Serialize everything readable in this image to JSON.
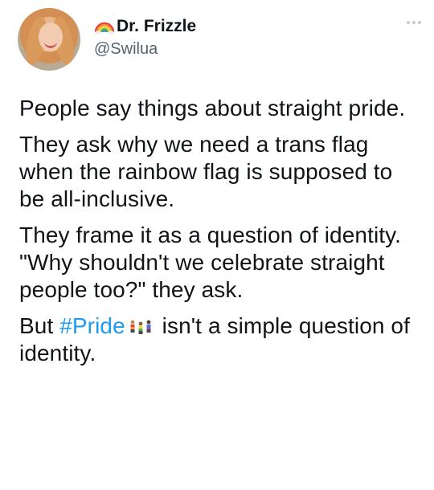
{
  "author": {
    "display_name": "Dr. Frizzle",
    "handle": "@Swilua",
    "name_icon": "rainbow-icon"
  },
  "menu": {
    "icon": "more-icon"
  },
  "tweet": {
    "paragraphs": [
      "People say things about straight pride.",
      "They ask why we need a trans flag when the rainbow flag is supposed to be all-inclusive.",
      "They frame it as a question of identity. \"Why shouldn't we celebrate straight people too?\" they ask."
    ],
    "last": {
      "before": "But ",
      "hashtag": "#Pride",
      "emoji": "pride-people-emoji",
      "after": " isn't a simple question of identity."
    }
  },
  "colors": {
    "text": "#0f1419",
    "secondary": "#536471",
    "link": "#1d9bf0"
  }
}
